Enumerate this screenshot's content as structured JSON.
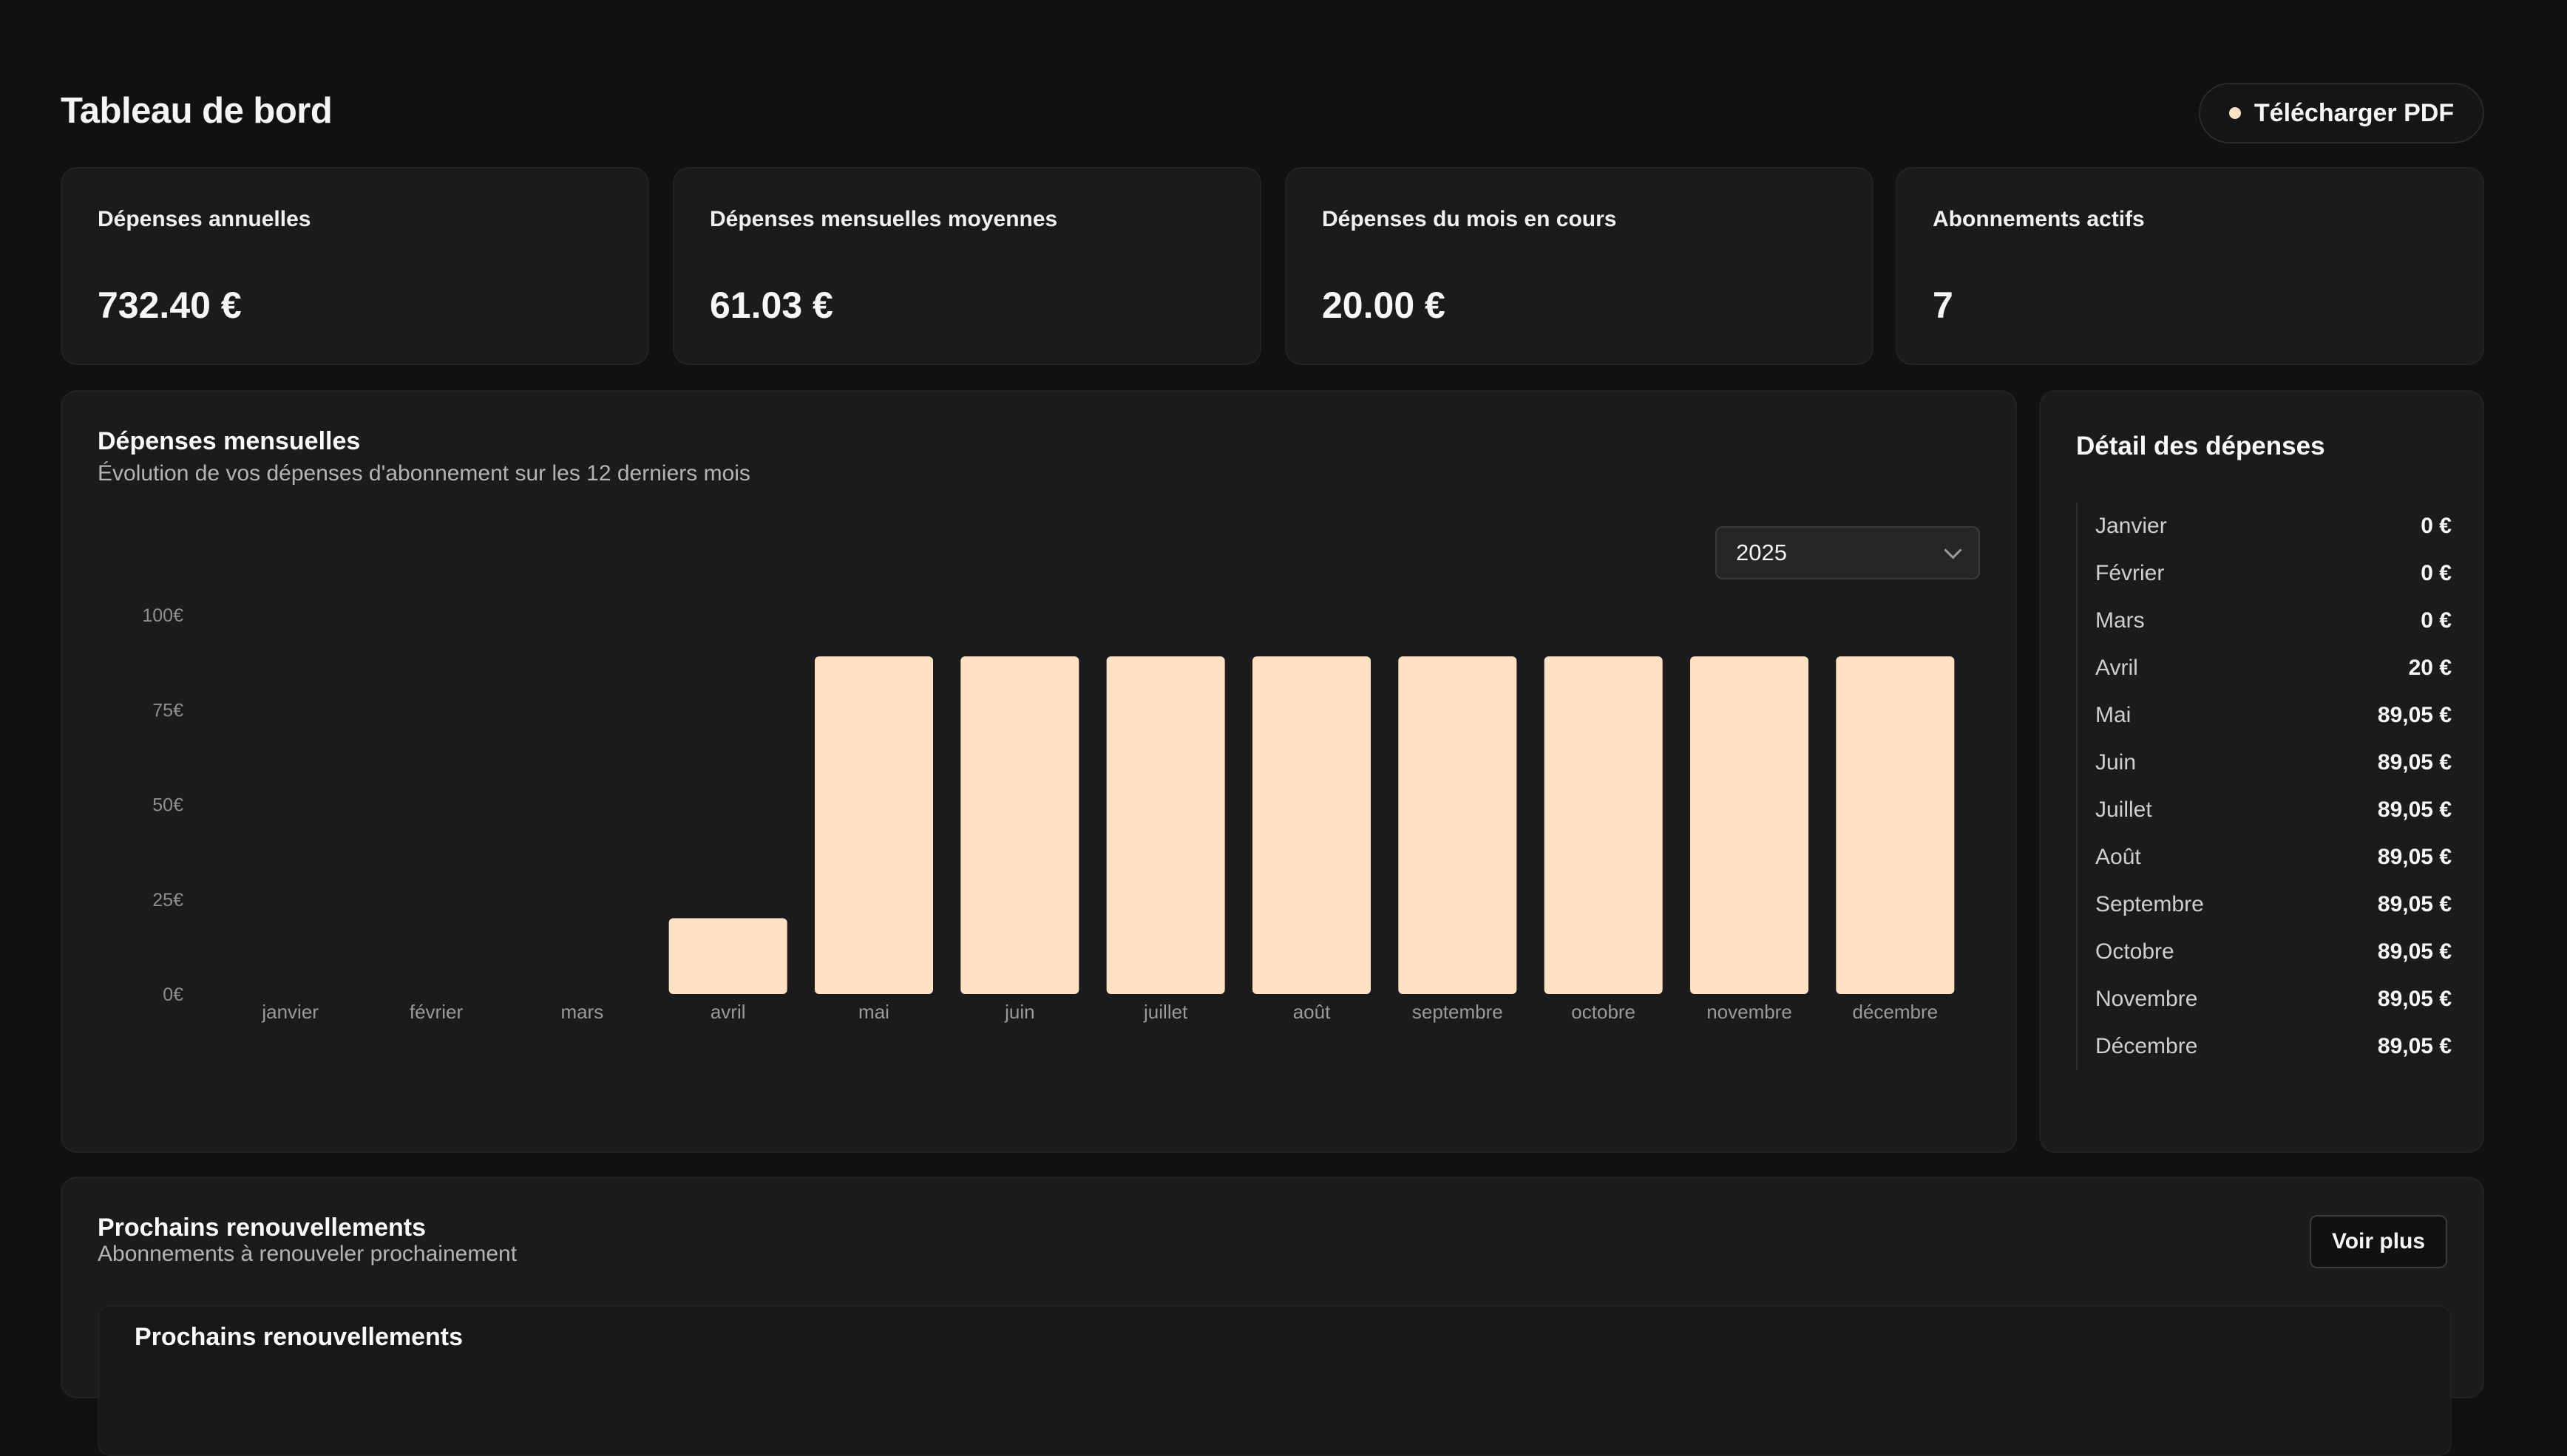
{
  "header": {
    "title": "Tableau de bord",
    "pdf_button_label": "Télécharger PDF"
  },
  "stats": [
    {
      "label": "Dépenses annuelles",
      "value": "732.40 €"
    },
    {
      "label": "Dépenses mensuelles moyennes",
      "value": "61.03 €"
    },
    {
      "label": "Dépenses du mois en cours",
      "value": "20.00 €"
    },
    {
      "label": "Abonnements actifs",
      "value": "7"
    }
  ],
  "monthly_chart": {
    "title": "Dépenses mensuelles",
    "subtitle": "Évolution de vos dépenses d'abonnement sur les 12 derniers mois",
    "year_selected": "2025"
  },
  "chart_data": {
    "type": "bar",
    "categories": [
      "janvier",
      "février",
      "mars",
      "avril",
      "mai",
      "juin",
      "juillet",
      "août",
      "septembre",
      "octobre",
      "novembre",
      "décembre"
    ],
    "values": [
      0,
      0,
      0,
      20,
      89.05,
      89.05,
      89.05,
      89.05,
      89.05,
      89.05,
      89.05,
      89.05
    ],
    "yticks": [
      "0€",
      "25€",
      "50€",
      "75€",
      "100€"
    ],
    "ylim": [
      0,
      100
    ],
    "bar_color": "#ffe1c4",
    "grid": false
  },
  "detail": {
    "title": "Détail des dépenses",
    "items": [
      {
        "month": "Janvier",
        "amount": "0 €"
      },
      {
        "month": "Février",
        "amount": "0 €"
      },
      {
        "month": "Mars",
        "amount": "0 €"
      },
      {
        "month": "Avril",
        "amount": "20 €"
      },
      {
        "month": "Mai",
        "amount": "89,05 €"
      },
      {
        "month": "Juin",
        "amount": "89,05 €"
      },
      {
        "month": "Juillet",
        "amount": "89,05 €"
      },
      {
        "month": "Août",
        "amount": "89,05 €"
      },
      {
        "month": "Septembre",
        "amount": "89,05 €"
      },
      {
        "month": "Octobre",
        "amount": "89,05 €"
      },
      {
        "month": "Novembre",
        "amount": "89,05 €"
      },
      {
        "month": "Décembre",
        "amount": "89,05 €"
      }
    ]
  },
  "renewals": {
    "title": "Prochains renouvellements",
    "subtitle": "Abonnements à renouveler prochainement",
    "button_label": "Voir plus",
    "panel_title": "Prochains renouvellements"
  },
  "colors": {
    "background": "#111111",
    "card": "#1b1b1b",
    "accent": "#ffe1c4"
  }
}
